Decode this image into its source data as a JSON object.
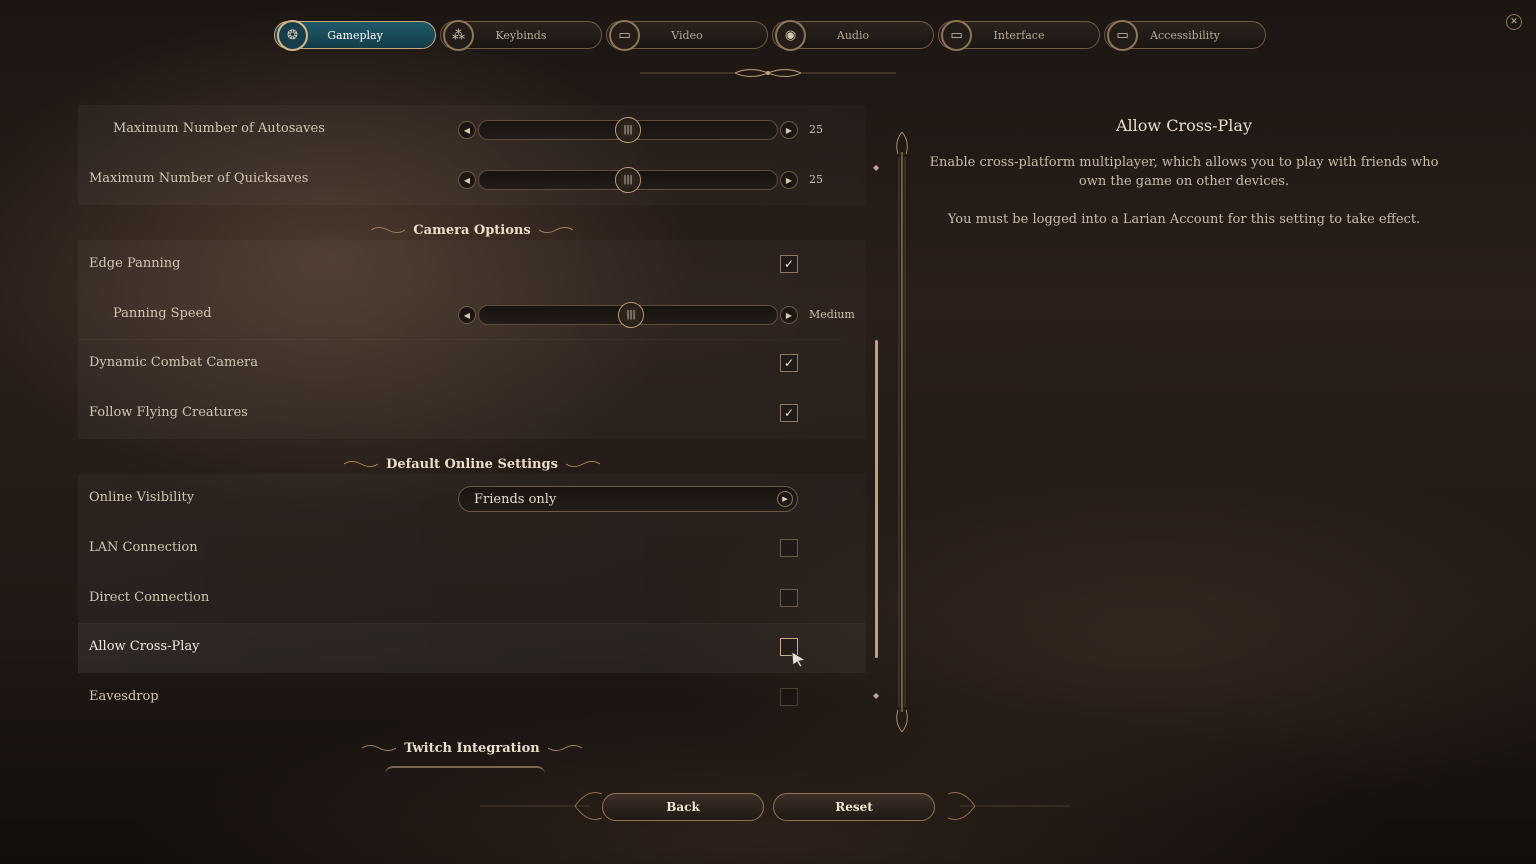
{
  "tabs": [
    {
      "label": "Gameplay",
      "icon": "gameplay-icon",
      "glyph": "❂",
      "active": true
    },
    {
      "label": "Keybinds",
      "icon": "keybinds-icon",
      "glyph": "⁂",
      "active": false
    },
    {
      "label": "Video",
      "icon": "monitor-icon",
      "glyph": "▭",
      "active": false
    },
    {
      "label": "Audio",
      "icon": "speaker-icon",
      "glyph": "◉",
      "active": false
    },
    {
      "label": "Interface",
      "icon": "monitor-icon",
      "glyph": "▭",
      "active": false
    },
    {
      "label": "Accessibility",
      "icon": "monitor-icon",
      "glyph": "▭",
      "active": false
    }
  ],
  "settings": {
    "autosaves": {
      "label": "Maximum Number of Autosaves",
      "value": "25",
      "level": 0.5
    },
    "quicksaves": {
      "label": "Maximum Number of Quicksaves",
      "value": "25",
      "level": 0.5
    },
    "camera_section": "Camera Options",
    "edge_panning": {
      "label": "Edge Panning",
      "checked": true
    },
    "panning_speed": {
      "label": "Panning Speed",
      "value": "Medium",
      "level": 0.51
    },
    "dynamic_camera": {
      "label": "Dynamic Combat Camera",
      "checked": true
    },
    "follow_flying": {
      "label": "Follow Flying Creatures",
      "checked": true
    },
    "online_section": "Default Online Settings",
    "online_visibility": {
      "label": "Online Visibility",
      "value": "Friends only"
    },
    "lan_connection": {
      "label": "LAN Connection",
      "checked": false
    },
    "direct_connection": {
      "label": "Direct Connection",
      "checked": false
    },
    "cross_play": {
      "label": "Allow Cross-Play",
      "checked": false
    },
    "eavesdrop": {
      "label": "Eavesdrop",
      "checked": false
    },
    "twitch_section": "Twitch Integration"
  },
  "description": {
    "title": "Allow Cross-Play",
    "paragraph1": "Enable cross-platform multiplayer, which allows you to play with friends who own the game on other devices.",
    "paragraph2": "You must be logged into a Larian Account for this setting to take effect."
  },
  "buttons": {
    "back": "Back",
    "reset": "Reset"
  },
  "glyphs": {
    "check": "✓",
    "slider_left": "◀",
    "slider_right": "▶",
    "thumb": "|||",
    "dropdown": "▶",
    "close": "✕",
    "scroll_up": "◆",
    "scroll_down": "◆"
  },
  "colors": {
    "accent_gold": "#c9a978",
    "active_tab": "#1f5a6a",
    "text": "#d2c6b4"
  }
}
